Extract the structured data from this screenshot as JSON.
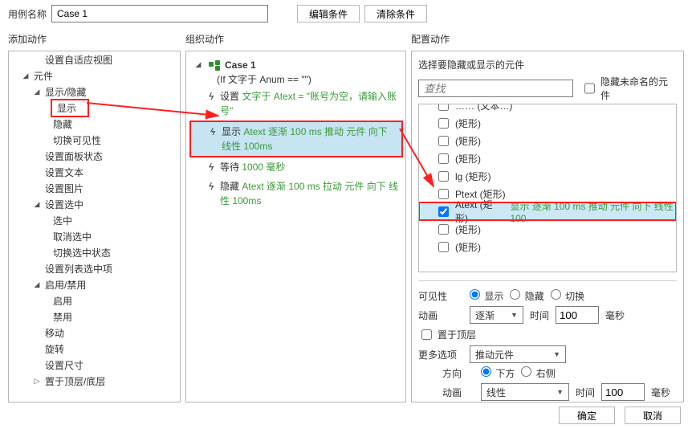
{
  "header": {
    "label": "用例名称",
    "value": "Case 1",
    "edit_btn": "编辑条件",
    "clear_btn": "清除条件"
  },
  "cols": {
    "left_title": "添加动作",
    "mid_title": "组织动作",
    "right_title": "配置动作"
  },
  "left_tree": {
    "n0": "设置自适应视图",
    "n1": "元件",
    "n2": "显示/隐藏",
    "n3": "显示",
    "n4": "隐藏",
    "n5": "切换可见性",
    "n6": "设置面板状态",
    "n7": "设置文本",
    "n8": "设置图片",
    "n9": "设置选中",
    "n10": "选中",
    "n11": "取消选中",
    "n12": "切换选中状态",
    "n13": "设置列表选中项",
    "n14": "启用/禁用",
    "n15": "启用",
    "n16": "禁用",
    "n17": "移动",
    "n18": "旋转",
    "n19": "设置尺寸",
    "n20": "置于顶层/底层"
  },
  "org": {
    "case_name": "Case 1",
    "case_cond": "(If 文字于 Anum == \"\")",
    "a1_verb": "设置",
    "a1_param": "文字于 Atext = \"账号为空，请输入账号\"",
    "a2_verb": "显示",
    "a2_param": "Atext 逐渐 100 ms 推动 元件 向下 线性 100ms",
    "a3_verb": "等待",
    "a3_param": "1000 毫秒",
    "a4_verb": "隐藏",
    "a4_param": "Atext 逐渐 100 ms 拉动 元件 向下 线性 100ms"
  },
  "right": {
    "choose_label": "选择要隐藏或显示的元件",
    "search_placeholder": "查找",
    "hide_unnamed": "隐藏未命名的元件",
    "list": {
      "top_cut": "…… (文本…)",
      "r1": "(矩形)",
      "r2": "(矩形)",
      "r3": "(矩形)",
      "r4": "lg (矩形)",
      "r5": "Ptext (矩形)",
      "r6_name": "Atext (矩形)",
      "r6_extra": "显示 逐渐 100 ms 推动 元件 向下 线性 100",
      "r7": "(矩形)",
      "r8": "(矩形)"
    },
    "vis_label": "可见性",
    "vis_show": "显示",
    "vis_hide": "隐藏",
    "vis_toggle": "切换",
    "anim_label": "动画",
    "anim_sel": "逐渐",
    "time_label": "时间",
    "time_val": "100",
    "ms": "毫秒",
    "bring_top": "置于顶层",
    "more_label": "更多选项",
    "more_sel": "推动元件",
    "dir_label": "方向",
    "dir_down": "下方",
    "dir_right": "右侧",
    "anim2_label": "动画",
    "anim2_sel": "线性",
    "time2_val": "100"
  },
  "footer": {
    "ok": "确定",
    "cancel": "取消"
  }
}
